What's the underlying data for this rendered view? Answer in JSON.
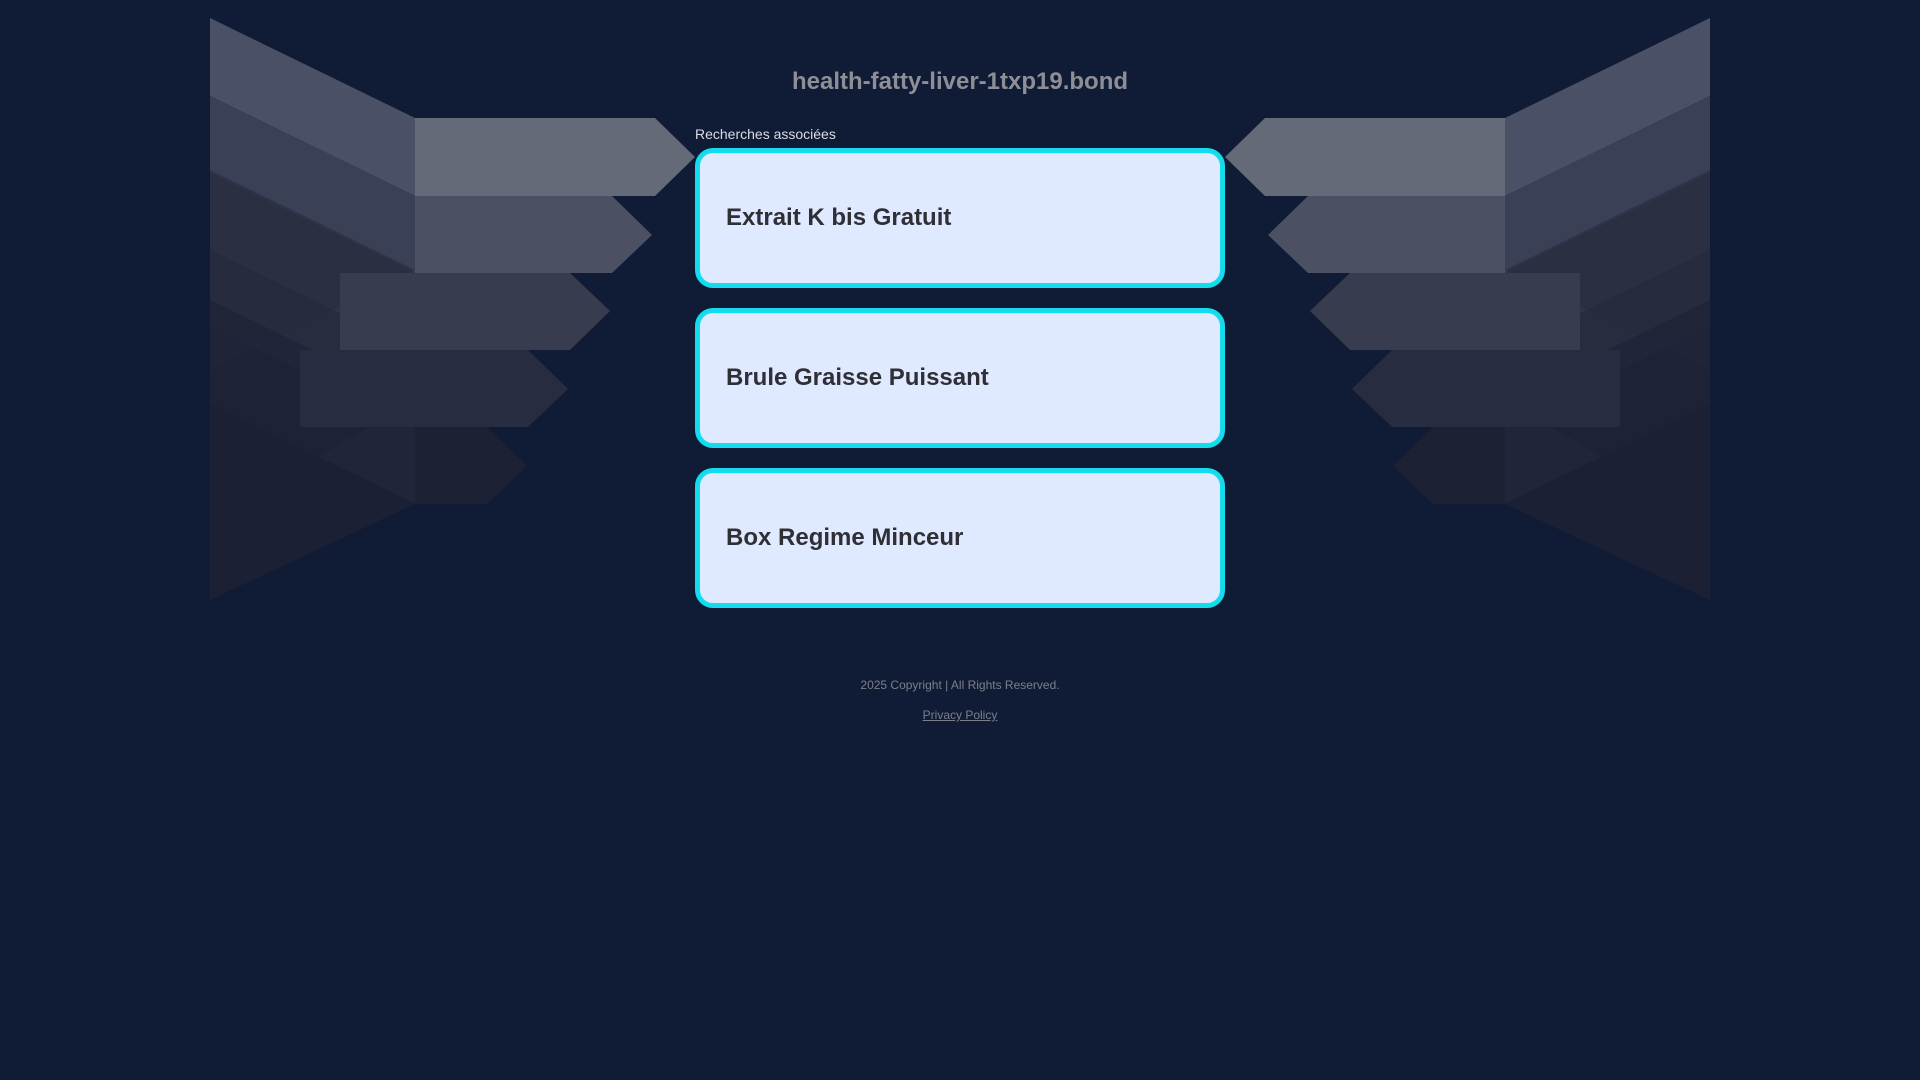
{
  "header": {
    "domain": "health-fatty-liver-1txp19.bond"
  },
  "related": {
    "heading": "Recherches associées",
    "links": [
      {
        "label": "Extrait K bis Gratuit"
      },
      {
        "label": "Brule Graisse Puissant"
      },
      {
        "label": "Box Regime Minceur"
      }
    ]
  },
  "footer": {
    "copyright": "2025 Copyright | All Rights Reserved.",
    "privacy_label": "Privacy Policy"
  },
  "colors": {
    "background": "#101c36",
    "card_fill": "#dfe9ff",
    "card_border": "#15dced",
    "card_text": "#2f2f35",
    "title": "#8e8e96"
  }
}
